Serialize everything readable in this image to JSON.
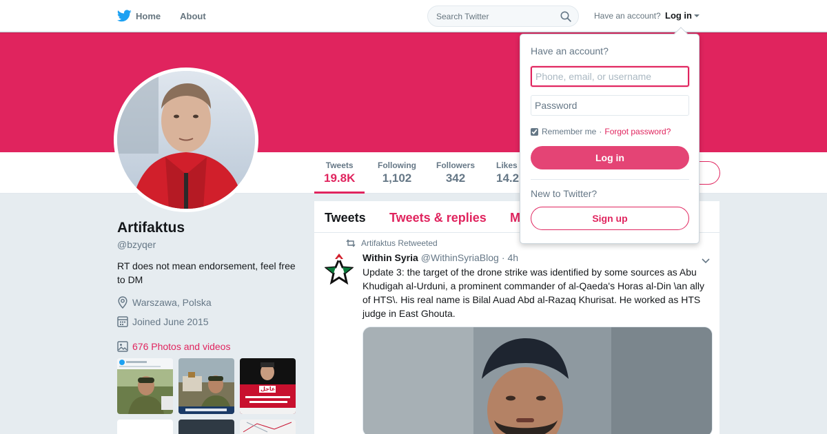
{
  "nav": {
    "home_label": "Home",
    "about_label": "About",
    "search_placeholder": "Search Twitter",
    "have_account": "Have an account?",
    "login_label": "Log in"
  },
  "theme": {
    "accent": "#e0245e",
    "text_secondary": "#657786",
    "background": "#e6ecf0"
  },
  "stats": [
    {
      "label": "Tweets",
      "value": "19.8K",
      "active": true
    },
    {
      "label": "Following",
      "value": "1,102",
      "active": false
    },
    {
      "label": "Followers",
      "value": "342",
      "active": false
    },
    {
      "label": "Likes",
      "value": "14.2",
      "active": false
    }
  ],
  "profile": {
    "name": "Artifaktus",
    "handle": "@bzyqer",
    "bio": "RT does not mean endorsement, feel free to DM",
    "location": "Warszawa, Polska",
    "joined": "Joined June 2015",
    "photos_link": "676 Photos and videos",
    "thumb_captions": [
      "",
      "",
      "عاجل"
    ]
  },
  "timeline": {
    "tabs": [
      "Tweets",
      "Tweets & replies",
      "M"
    ],
    "retweet_context": "Artifaktus Retweeted",
    "tweet": {
      "author_name": "Within Syria",
      "author_handle": "@WithinSyriaBlog",
      "separator": "·",
      "time": "4h",
      "text": "Update 3: the target of the drone strike was identified by some sources as Abu Khudigah al-Urduni, a prominent commander of al-Qaeda's Horas al-Din \\an ally of HTS\\. His real name is Bilal Auad Abd al-Razaq Khurisat. He worked as HTS judge in East Ghouta."
    }
  },
  "login_dropdown": {
    "title": "Have an account?",
    "username_placeholder": "Phone, email, or username",
    "password_placeholder": "Password",
    "remember_label": "Remember me",
    "separator": "·",
    "forgot_label": "Forgot password?",
    "login_button": "Log in",
    "new_label": "New to Twitter?",
    "signup_button": "Sign up"
  }
}
